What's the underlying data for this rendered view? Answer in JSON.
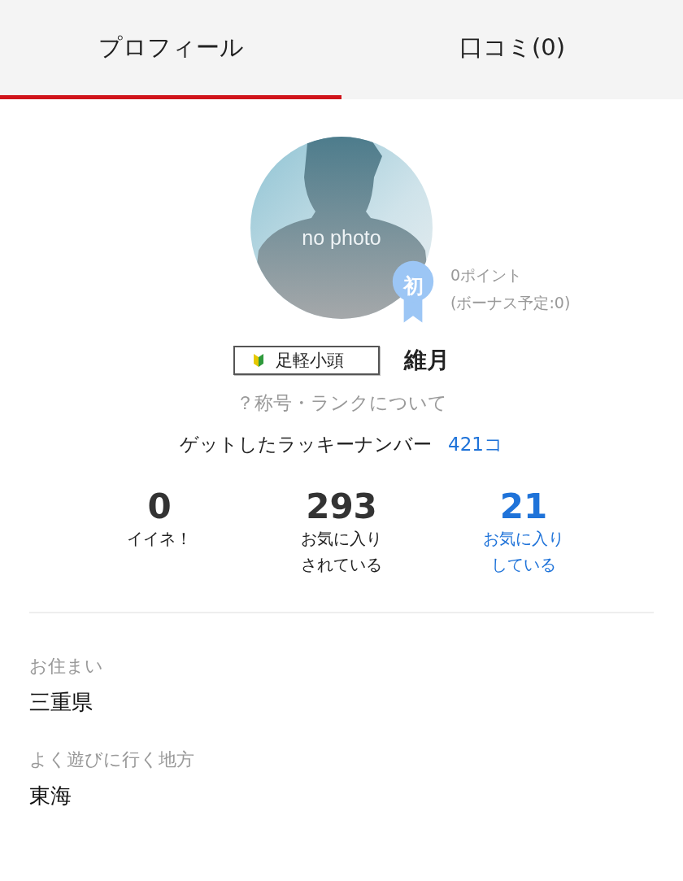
{
  "tabs": [
    {
      "label": "プロフィール",
      "selected": true
    },
    {
      "label": "口コミ(0)",
      "selected": false
    }
  ],
  "profile": {
    "avatar_caption": "no photo",
    "badge": "初",
    "points": "0ポイント",
    "bonus": "(ボーナス予定:0)",
    "rank_title": "足軽小頭",
    "name": "維月",
    "rank_info_link": "？称号・ランクについて",
    "lucky_label": "ゲットしたラッキーナンバー",
    "lucky_count": "421コ"
  },
  "stats": [
    {
      "value": "0",
      "label": [
        "イイネ！"
      ],
      "kind": "plain"
    },
    {
      "value": "293",
      "label": [
        "お気に入り",
        "されている"
      ],
      "kind": "plain"
    },
    {
      "value": "21",
      "label": [
        "お気に入り",
        "している"
      ],
      "kind": "link"
    }
  ],
  "details": [
    {
      "label": "お住まい",
      "value": "三重県"
    },
    {
      "label": "よく遊びに行く地方",
      "value": "東海"
    }
  ]
}
